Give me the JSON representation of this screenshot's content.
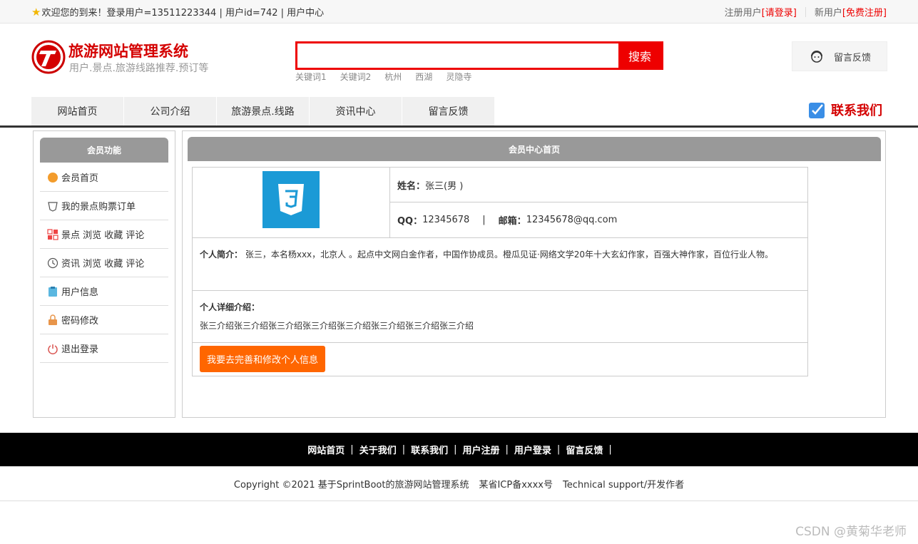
{
  "topbar": {
    "welcome": "欢迎您的到来！登录用户=13511223344 | 用户id=742 | 用户中心",
    "register_label": "注册用户",
    "login_link": "[请登录]",
    "new_user_label": "新用户",
    "signup_link": "[免费注册]"
  },
  "header": {
    "title": "旅游网站管理系统",
    "subtitle": "用户.景点.旅游线路推荐.预订等",
    "search_placeholder": "",
    "search_button": "搜索",
    "keywords": [
      "关键词1",
      "关键词2",
      "杭州",
      "西湖",
      "灵隐寺"
    ],
    "feedback": "留言反馈"
  },
  "nav": {
    "items": [
      "网站首页",
      "公司介绍",
      "旅游景点.线路",
      "资讯中心",
      "留言反馈"
    ],
    "contact": "联系我们"
  },
  "sidebar": {
    "title": "会员功能",
    "items": [
      {
        "label": "会员首页",
        "icon": "home-icon"
      },
      {
        "label": "我的景点购票订单",
        "icon": "tag-icon"
      },
      {
        "label": "景点 浏览 收藏 评论",
        "icon": "grid-icon"
      },
      {
        "label": "资讯 浏览 收藏 评论",
        "icon": "clock-icon"
      },
      {
        "label": "用户信息",
        "icon": "clipboard-icon"
      },
      {
        "label": "密码修改",
        "icon": "lock-icon"
      },
      {
        "label": "退出登录",
        "icon": "power-icon"
      }
    ]
  },
  "main": {
    "title": "会员中心首页",
    "name_label": "姓名：",
    "name_value": "张三(男 )",
    "qq_label": "QQ：",
    "qq_value": "12345678",
    "divider": "|",
    "email_label": "邮箱：",
    "email_value": "12345678@qq.com",
    "bio_label": "个人简介：",
    "bio_value": "张三，本名杨xxx，北京人 。起点中文网白金作者，中国作协成员。橙瓜见证·网络文学20年十大玄幻作家，百强大神作家，百位行业人物。",
    "detail_label": "个人详细介绍：",
    "detail_value": "张三介绍张三介绍张三介绍张三介绍张三介绍张三介绍张三介绍张三介绍",
    "edit_button": "我要去完善和修改个人信息"
  },
  "footer": {
    "links": [
      "网站首页",
      "关于我们",
      "联系我们",
      "用户注册",
      "用户登录",
      "留言反馈"
    ],
    "separator": "|",
    "copyright": "Copyright ©2021 基于SprintBoot的旅游网站管理系统",
    "icp": "某省ICP备xxxx号",
    "support": "Technical support/开发作者"
  },
  "watermark": "CSDN @黄菊华老师",
  "colors": {
    "brand_red": "#d40000",
    "accent_orange": "#ff6600",
    "header_gray": "#999999"
  }
}
